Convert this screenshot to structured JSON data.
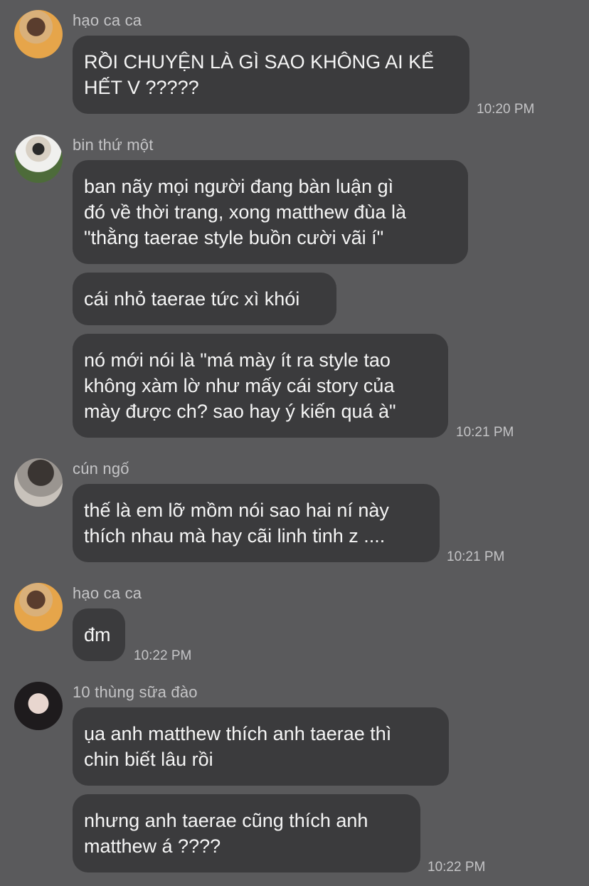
{
  "messages": [
    {
      "sender": "hạo ca ca",
      "bubbles": [
        "RỒI CHUYỆN LÀ GÌ SAO KHÔNG AI KỂ\nHẾT V ?????"
      ],
      "time": "10:20 PM"
    },
    {
      "sender": "bin thứ một",
      "bubbles": [
        "ban nãy mọi người đang bàn luận gì\nđó về thời trang, xong matthew đùa là\n\"thằng taerae style buồn cười vãi í\"",
        "cái nhỏ taerae tức xì khói",
        "nó mới nói là \"má mày ít ra style tao\nkhông xàm lờ như mấy cái story của\nmày được ch? sao hay ý kiến quá à\""
      ],
      "time": "10:21 PM"
    },
    {
      "sender": "cún ngố",
      "bubbles": [
        "thế là em lỡ mồm nói sao hai ní này\nthích nhau mà hay cãi linh tinh z ...."
      ],
      "time": "10:21 PM"
    },
    {
      "sender": "hạo ca ca",
      "bubbles": [
        "đm"
      ],
      "time": "10:22 PM"
    },
    {
      "sender": "10 thùng sữa đào",
      "bubbles": [
        "ụa anh matthew thích anh taerae thì\nchin biết lâu rồi",
        "nhưng anh taerae cũng thích anh\nmatthew á ????"
      ],
      "time": "10:22 PM"
    }
  ]
}
